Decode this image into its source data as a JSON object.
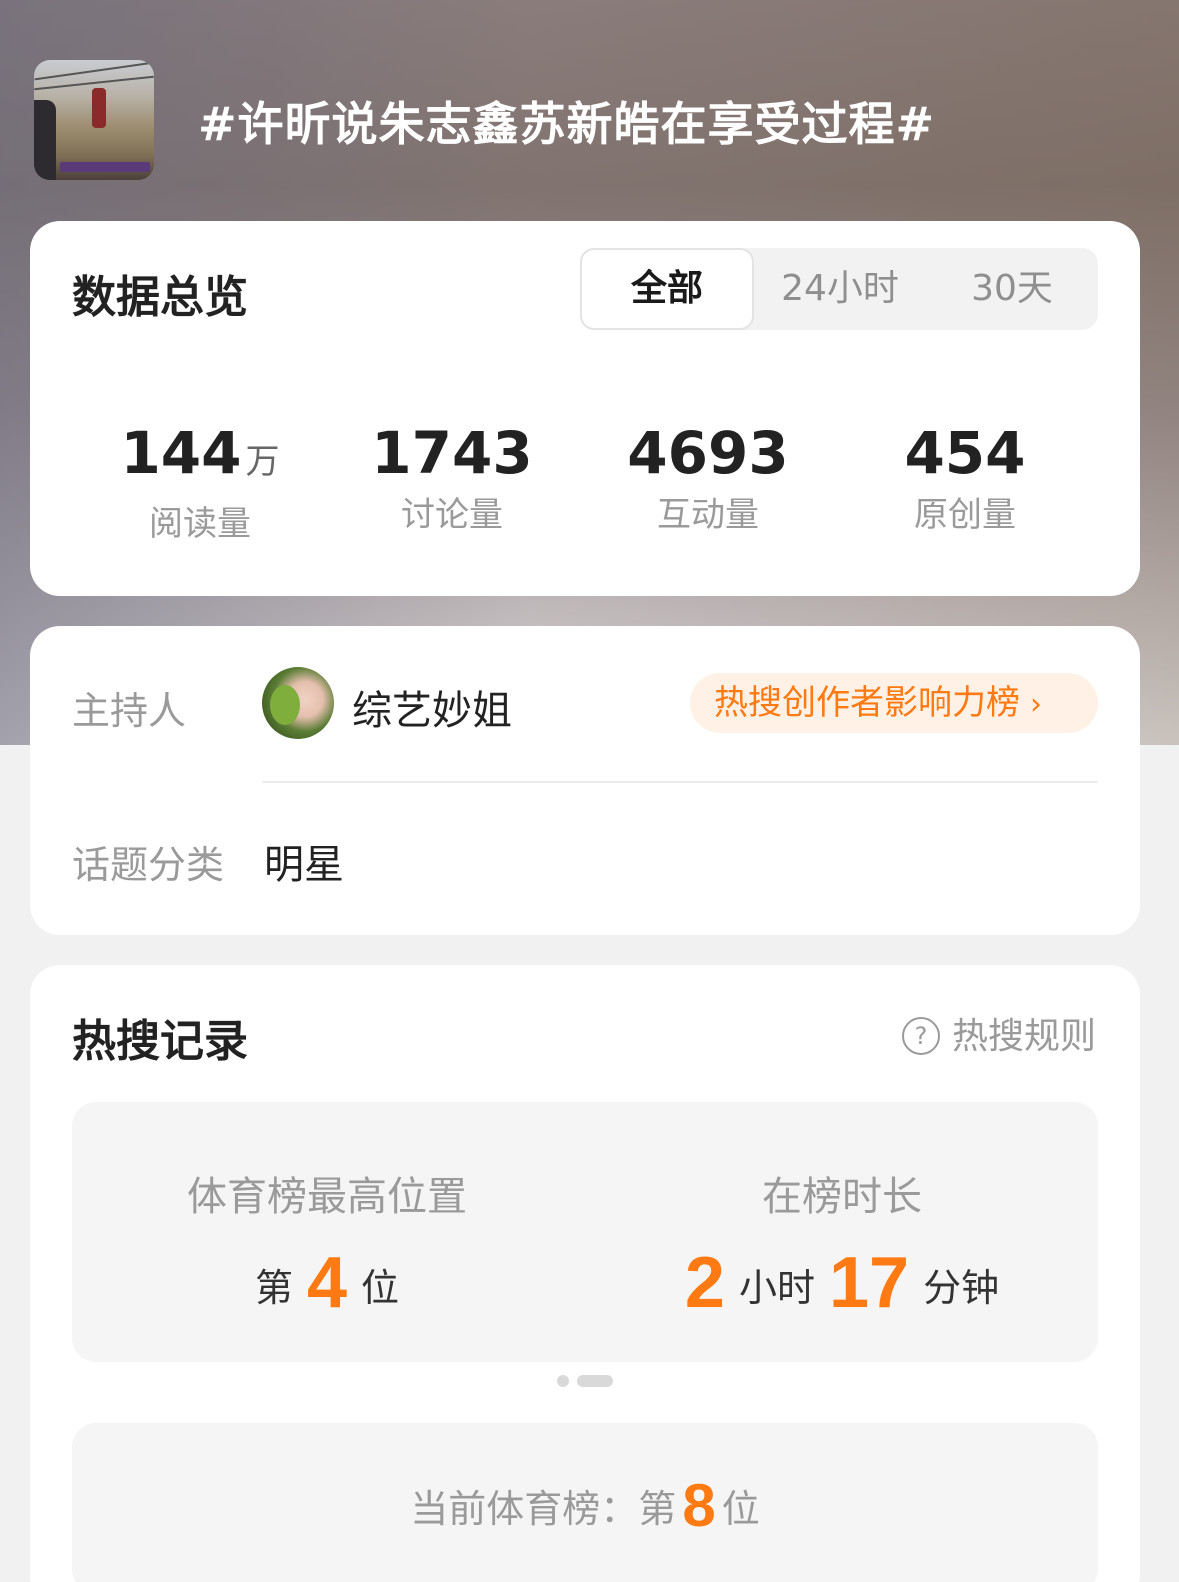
{
  "header": {
    "topic_title": "#许昕说朱志鑫苏新皓在享受过程#",
    "thumbnail_icon": "topic-thumbnail-image"
  },
  "overview": {
    "title": "数据总览",
    "tabs": [
      {
        "label": "全部",
        "active": true
      },
      {
        "label": "24小时",
        "active": false
      },
      {
        "label": "30天",
        "active": false
      }
    ],
    "stats": [
      {
        "value": "144",
        "unit": "万",
        "label": "阅读量"
      },
      {
        "value": "1743",
        "unit": "",
        "label": "讨论量"
      },
      {
        "value": "4693",
        "unit": "",
        "label": "互动量"
      },
      {
        "value": "454",
        "unit": "",
        "label": "原创量"
      }
    ]
  },
  "host": {
    "host_label": "主持人",
    "host_name": "综艺妙姐",
    "rank_link": "热搜创作者影响力榜",
    "rank_chevron": "›",
    "category_label": "话题分类",
    "category_value": "明星"
  },
  "hot_record": {
    "title": "热搜记录",
    "rules_icon": "?",
    "rules_label": "热搜规则",
    "highest": {
      "title": "体育榜最高位置",
      "prefix": "第",
      "value": "4",
      "suffix": "位"
    },
    "duration": {
      "title": "在榜时长",
      "hours": "2",
      "hours_unit": "小时",
      "minutes": "17",
      "minutes_unit": "分钟"
    },
    "current": {
      "label": "当前体育榜：",
      "prefix": "第",
      "value": "8",
      "suffix": "位"
    }
  },
  "colors": {
    "accent": "#ff7a12",
    "pill_bg": "#fff1e6",
    "muted_text": "#9a9a9a"
  }
}
